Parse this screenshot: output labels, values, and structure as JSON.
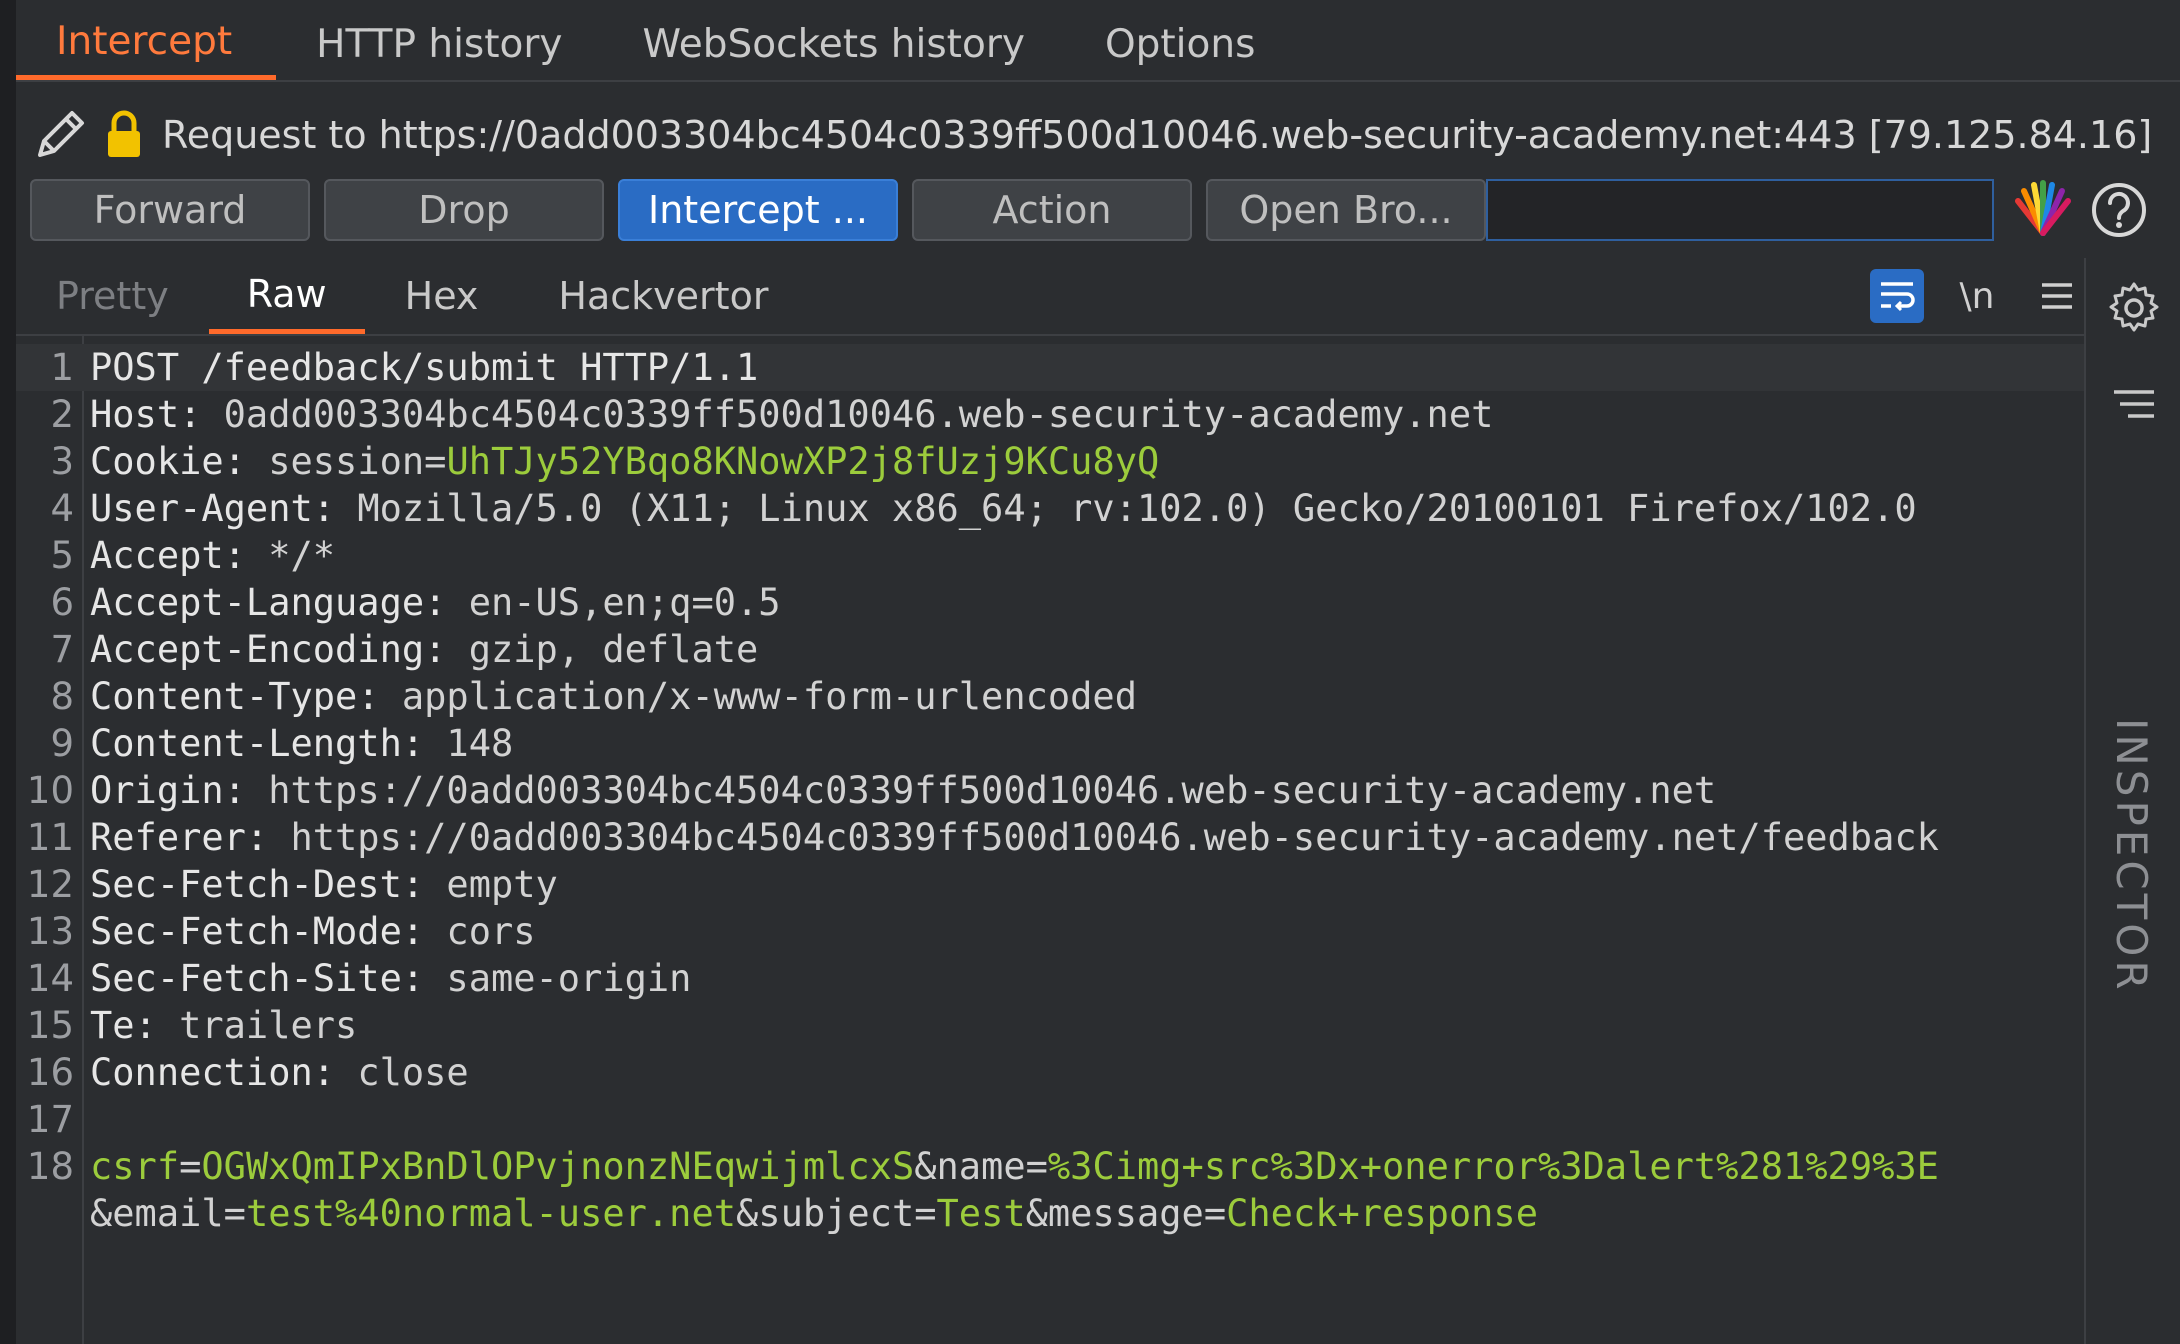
{
  "top_tabs": [
    "Intercept",
    "HTTP history",
    "WebSockets history",
    "Options"
  ],
  "request_to": "Request to https://0add003304bc4504c0339ff500d10046.web-security-academy.net:443  [79.125.84.16]",
  "buttons": {
    "forward": "Forward",
    "drop": "Drop",
    "intercept": "Intercept ...",
    "action": "Action",
    "open_browser": "Open Bro..."
  },
  "search": {
    "value": "",
    "placeholder": ""
  },
  "editor_tabs": [
    "Pretty",
    "Raw",
    "Hex",
    "Hackvertor"
  ],
  "tools": {
    "newline": "\\n"
  },
  "inspector_label": "INSPECTOR",
  "lines": {
    "n1": "1",
    "n2": "2",
    "n3": "3",
    "n4": "4",
    "n5": "5",
    "n6": "6",
    "n7": "7",
    "n8": "8",
    "n9": "9",
    "n10": "10",
    "n11": "11",
    "n12": "12",
    "n13": "13",
    "n14": "14",
    "n15": "15",
    "n16": "16",
    "n17": "17",
    "n18": "18",
    "l1": "POST /feedback/submit HTTP/1.1",
    "l2k": "Host: ",
    "l2v": "0add003304bc4504c0339ff500d10046.web-security-academy.net",
    "l3k": "Cookie: ",
    "l3n": "session",
    "l3e": "=",
    "l3v": "UhTJy52YBqo8KNowXP2j8fUzj9KCu8yQ",
    "l4k": "User-Agent: ",
    "l4v": "Mozilla/5.0 (X11; Linux x86_64; rv:102.0) Gecko/20100101 Firefox/102.0",
    "l5k": "Accept: ",
    "l5v": "*/*",
    "l6k": "Accept-Language: ",
    "l6v": "en-US,en;q=0.5",
    "l7k": "Accept-Encoding: ",
    "l7v": "gzip, deflate",
    "l8k": "Content-Type: ",
    "l8v": "application/x-www-form-urlencoded",
    "l9k": "Content-Length: ",
    "l9v": "148",
    "l10k": "Origin: ",
    "l10v": "https://0add003304bc4504c0339ff500d10046.web-security-academy.net",
    "l11k": "Referer: ",
    "l11v": "https://0add003304bc4504c0339ff500d10046.web-security-academy.net/feedback",
    "l12k": "Sec-Fetch-Dest: ",
    "l12v": "empty",
    "l13k": "Sec-Fetch-Mode: ",
    "l13v": "cors",
    "l14k": "Sec-Fetch-Site: ",
    "l14v": "same-origin",
    "l15k": "Te: ",
    "l15v": "trailers",
    "l16k": "Connection: ",
    "l16v": "close",
    "body": {
      "p1k": "csrf",
      "p1v": "OGWxQmIPxBnDlOPvjnonzNEqwijmlcxS",
      "p2k": "&name",
      "p2v": "%3Cimg+src%3Dx+onerror%3Dalert%281%29%3E",
      "p3k": "&email",
      "p3v": "test%40normal-user.net",
      "p4k": "&subject",
      "p4v": "Test",
      "p5k": "&message",
      "p5v": "Check+response",
      "eq": "="
    }
  }
}
